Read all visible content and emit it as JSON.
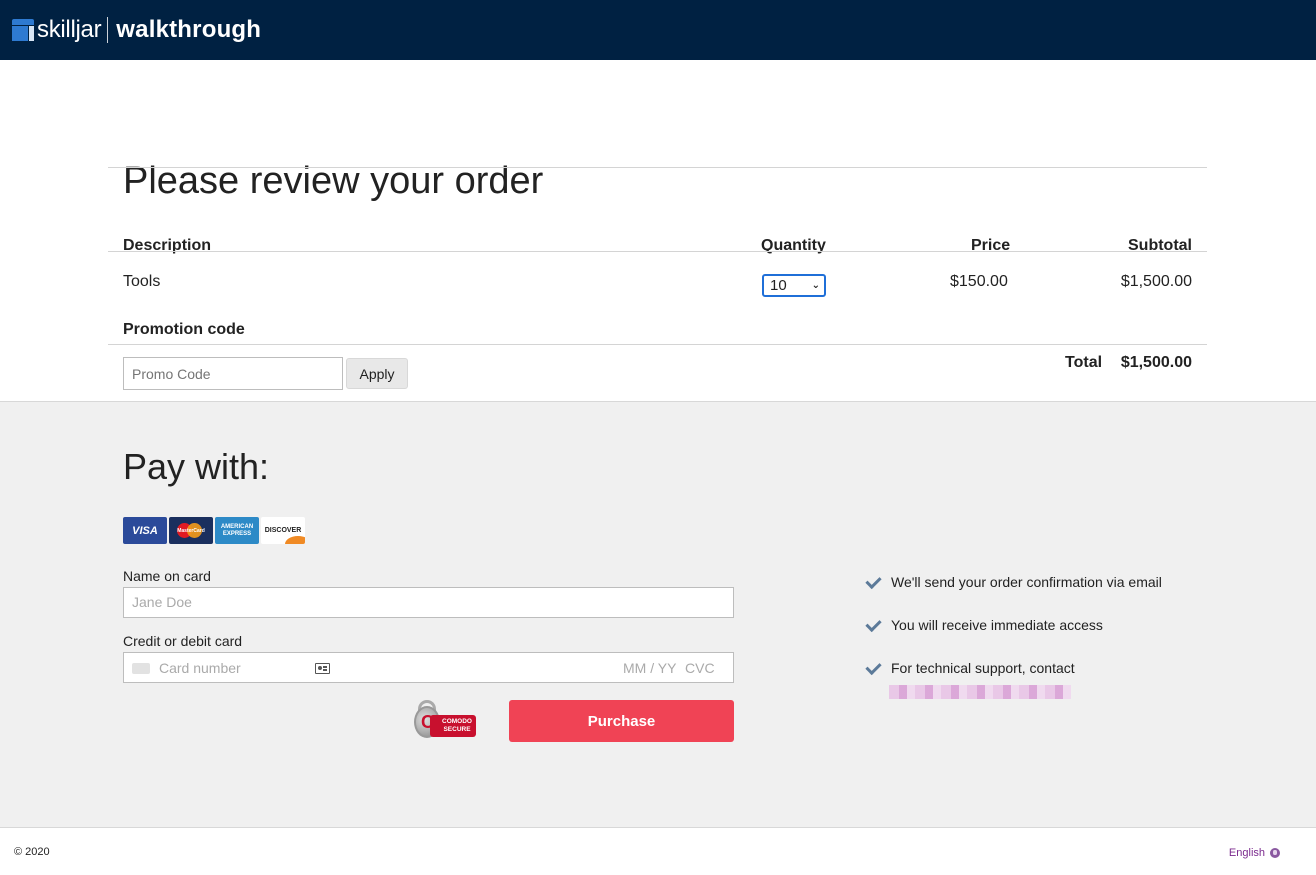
{
  "header": {
    "brand_name": "skilljar",
    "product_name": "walkthrough"
  },
  "order": {
    "title": "Please review your order",
    "columns": {
      "description": "Description",
      "quantity": "Quantity",
      "price": "Price",
      "subtotal": "Subtotal"
    },
    "items": [
      {
        "description": "Tools",
        "quantity": "10",
        "price": "$150.00",
        "subtotal": "$1,500.00"
      }
    ],
    "promotion": {
      "label": "Promotion code",
      "placeholder": "Promo Code",
      "apply_label": "Apply"
    },
    "total_label": "Total",
    "total_value": "$1,500.00"
  },
  "payment": {
    "title": "Pay with:",
    "card_brands": [
      {
        "name": "visa-icon",
        "label": "VISA"
      },
      {
        "name": "mastercard-icon",
        "label": "MasterCard"
      },
      {
        "name": "amex-icon",
        "label": "AMERICAN EXPRESS"
      },
      {
        "name": "discover-icon",
        "label": "DISCOVER"
      }
    ],
    "name_label": "Name on card",
    "name_placeholder": "Jane Doe",
    "card_label": "Credit or debit card",
    "card_number_placeholder": "Card number",
    "expiry_placeholder": "MM / YY",
    "cvc_placeholder": "CVC",
    "security_badge": "COMODO SECURE",
    "purchase_label": "Purchase",
    "assurances": [
      "We'll send your order confirmation via email",
      "You will receive immediate access",
      "For technical support, contact"
    ],
    "colors": {
      "purchase_button": "#f04355",
      "header_bg": "#002142",
      "check_icon": "#5c7a99"
    }
  },
  "footer": {
    "copyright": "© 2020",
    "language": "English"
  }
}
